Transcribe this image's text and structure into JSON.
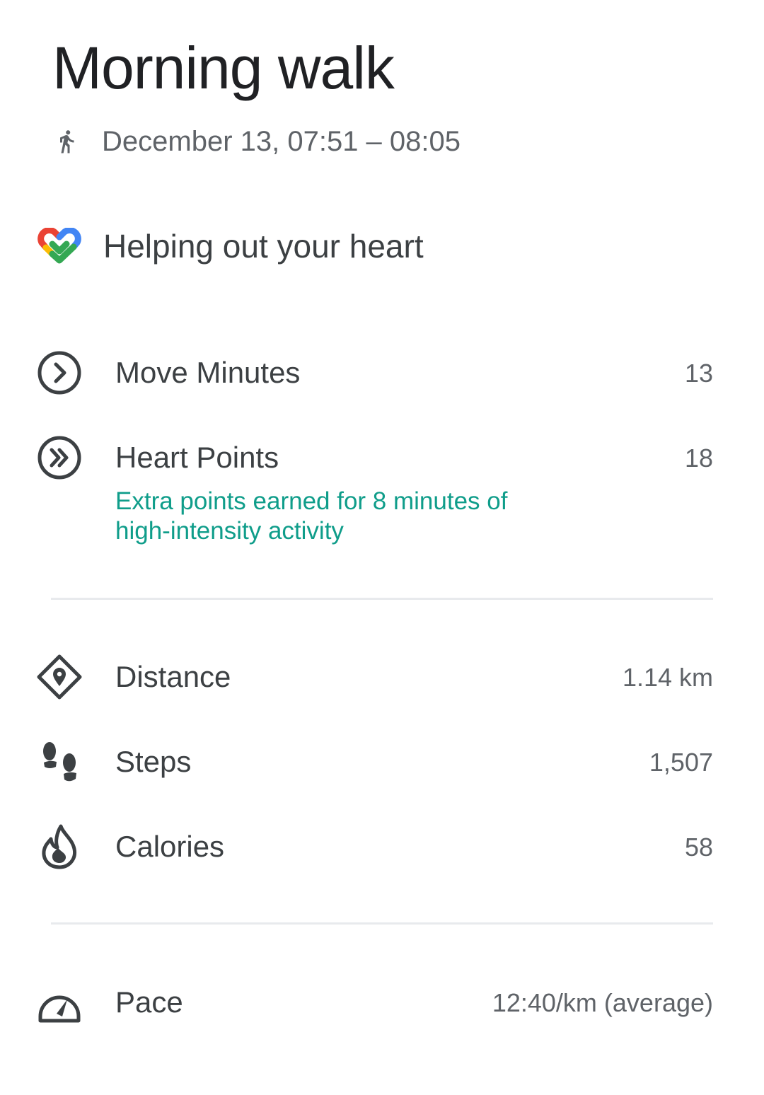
{
  "activity": {
    "title": "Morning walk",
    "time_range": "December 13, 07:51 – 08:05",
    "activity_icon": "walking-person-icon"
  },
  "heart_section": {
    "heading": "Helping out your heart",
    "icon": "google-fit-heart-logo",
    "logo_colors": [
      "#EA4335",
      "#4285F4",
      "#FBBC04",
      "#34A853"
    ],
    "move_minutes": {
      "label": "Move Minutes",
      "value": "13",
      "icon": "move-minutes-icon"
    },
    "heart_points": {
      "label": "Heart Points",
      "value": "18",
      "icon": "heart-points-icon",
      "note": "Extra points earned for 8 minutes of high-intensity activity",
      "note_color": "#0F9D8A"
    }
  },
  "stats": {
    "distance": {
      "label": "Distance",
      "value": "1.14 km",
      "icon": "location-diamond-icon"
    },
    "steps": {
      "label": "Steps",
      "value": "1,507",
      "icon": "footprints-icon"
    },
    "calories": {
      "label": "Calories",
      "value": "58",
      "icon": "flame-icon"
    }
  },
  "pace": {
    "label": "Pace",
    "value": "12:40/km (average)",
    "icon": "speedometer-icon"
  }
}
